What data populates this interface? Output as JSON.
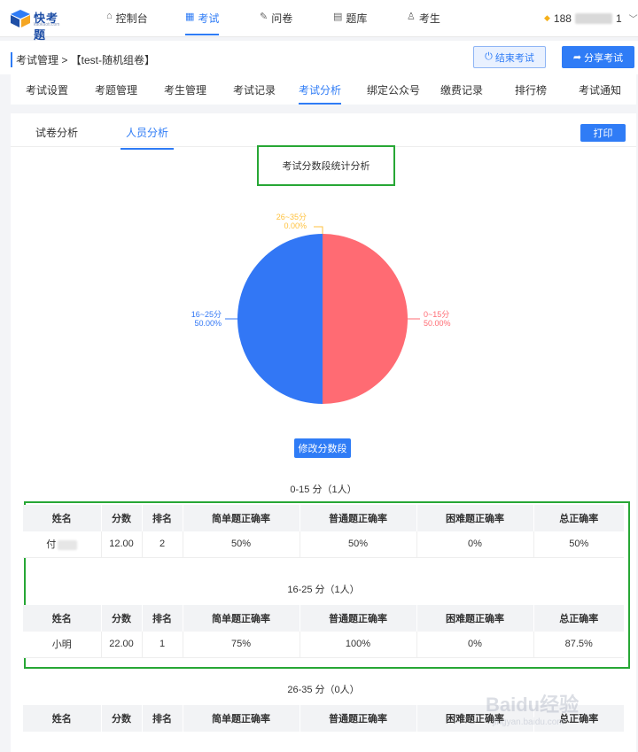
{
  "brand": {
    "name": "快考题",
    "sub": "kaokaoti.com"
  },
  "nav": [
    {
      "label": "控制台",
      "icon": "home-icon",
      "glyph": "⌂"
    },
    {
      "label": "考试",
      "icon": "calendar-icon",
      "glyph": "▦"
    },
    {
      "label": "问卷",
      "icon": "edit-icon",
      "glyph": "✎"
    },
    {
      "label": "题库",
      "icon": "document-icon",
      "glyph": "▤"
    },
    {
      "label": "考生",
      "icon": "user-icon",
      "glyph": "♙"
    }
  ],
  "user": {
    "phone_prefix": "188",
    "phone_suffix": "1"
  },
  "breadcrumb": "考试管理 > 【test-随机组卷】",
  "actions": {
    "end_label": "结束考试",
    "share_label": "分享考试"
  },
  "subtabs": [
    "考试设置",
    "考题管理",
    "考生管理",
    "考试记录",
    "考试分析",
    "绑定公众号",
    "缴费记录",
    "排行榜",
    "考试通知"
  ],
  "inner_tabs": [
    "试卷分析",
    "人员分析"
  ],
  "print_label": "打印",
  "modify_label": "修改分数段",
  "chart_data": {
    "type": "pie",
    "title": "考试分数段统计分析",
    "slices": [
      {
        "label": "0~15分",
        "percent": "50.00%",
        "value": 50,
        "color": "#ff6b73"
      },
      {
        "label": "16~25分",
        "percent": "50.00%",
        "value": 50,
        "color": "#3277f5"
      },
      {
        "label": "26~35分",
        "percent": "0.00%",
        "value": 0,
        "color": "#ffc23f"
      }
    ]
  },
  "columns": [
    "姓名",
    "分数",
    "排名",
    "简单题正确率",
    "普通题正确率",
    "困难题正确率",
    "总正确率"
  ],
  "sections": [
    {
      "title": "0-15 分（1人）",
      "rows": [
        {
          "name": "付",
          "score": "12.00",
          "rank": "2",
          "easy": "50%",
          "normal": "50%",
          "hard": "0%",
          "total": "50%"
        }
      ]
    },
    {
      "title": "16-25 分（1人）",
      "rows": [
        {
          "name": "小明",
          "score": "22.00",
          "rank": "1",
          "easy": "75%",
          "normal": "100%",
          "hard": "0%",
          "total": "87.5%"
        }
      ]
    },
    {
      "title": "26-35 分（0人）",
      "rows": []
    }
  ],
  "watermark": {
    "text": "Baidu经验",
    "url": "jingyan.baidu.com"
  }
}
